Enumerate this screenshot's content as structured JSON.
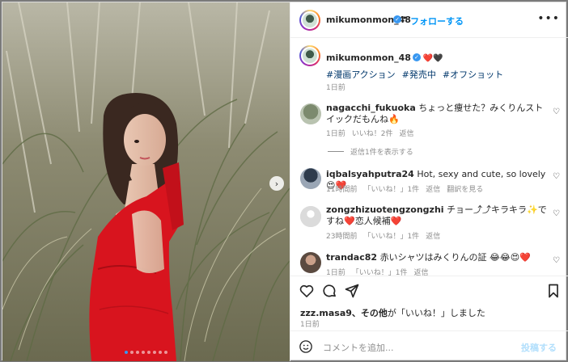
{
  "header": {
    "username": "mikumonmon_48",
    "separator": "•",
    "follow_label": "フォローする",
    "more_icon": "more-horizontal-icon"
  },
  "caption": {
    "username": "mikumonmon_48",
    "hearts": "❤️🖤",
    "tags": [
      "#漫画アクション",
      "#発売中",
      "#オフショット"
    ],
    "time": "1日前"
  },
  "comments": [
    {
      "username": "nagacchi_fukuoka",
      "text": "ちょっと痩せた？みくりんストイックだもんね🔥",
      "time": "1日前",
      "likes": "いいね！2件",
      "reply": "返信",
      "view_replies": "返信1件を表示する"
    },
    {
      "username": "iqbalsyahputra24",
      "text": "Hot, sexy and cute, so lovely 😍❤️",
      "time": "11時間前",
      "likes": "「いいね！」1件",
      "reply": "返信",
      "translate": "翻訳を見る"
    },
    {
      "username": "zongzhizuotengzongzhi",
      "text": "チョー⤴︎⤴︎キラキラ✨ですね❤️恋人候補❤️",
      "time": "23時間前",
      "likes": "「いいね！」1件",
      "reply": "返信"
    },
    {
      "username": "trandac82",
      "text": "赤いシャツはみくりんの証 😂😂😍❤️",
      "time": "1日前",
      "likes": "「いいね！」1件",
      "reply": "返信"
    }
  ],
  "actions": {
    "icons": [
      "heart-icon",
      "comment-icon",
      "share-icon",
      "bookmark-icon"
    ],
    "likes_user": "zzz.masa9",
    "likes_rest": "、その他",
    "likes_suffix": "が「いいね！」しました",
    "time": "1日前"
  },
  "add_comment": {
    "placeholder": "コメントを追加...",
    "post_label": "投稿する"
  },
  "carousel": {
    "slides": 8,
    "active": 1
  },
  "colors": {
    "accent": "#0095f6",
    "dress": "#d8141e",
    "hashtag": "#00376b"
  }
}
